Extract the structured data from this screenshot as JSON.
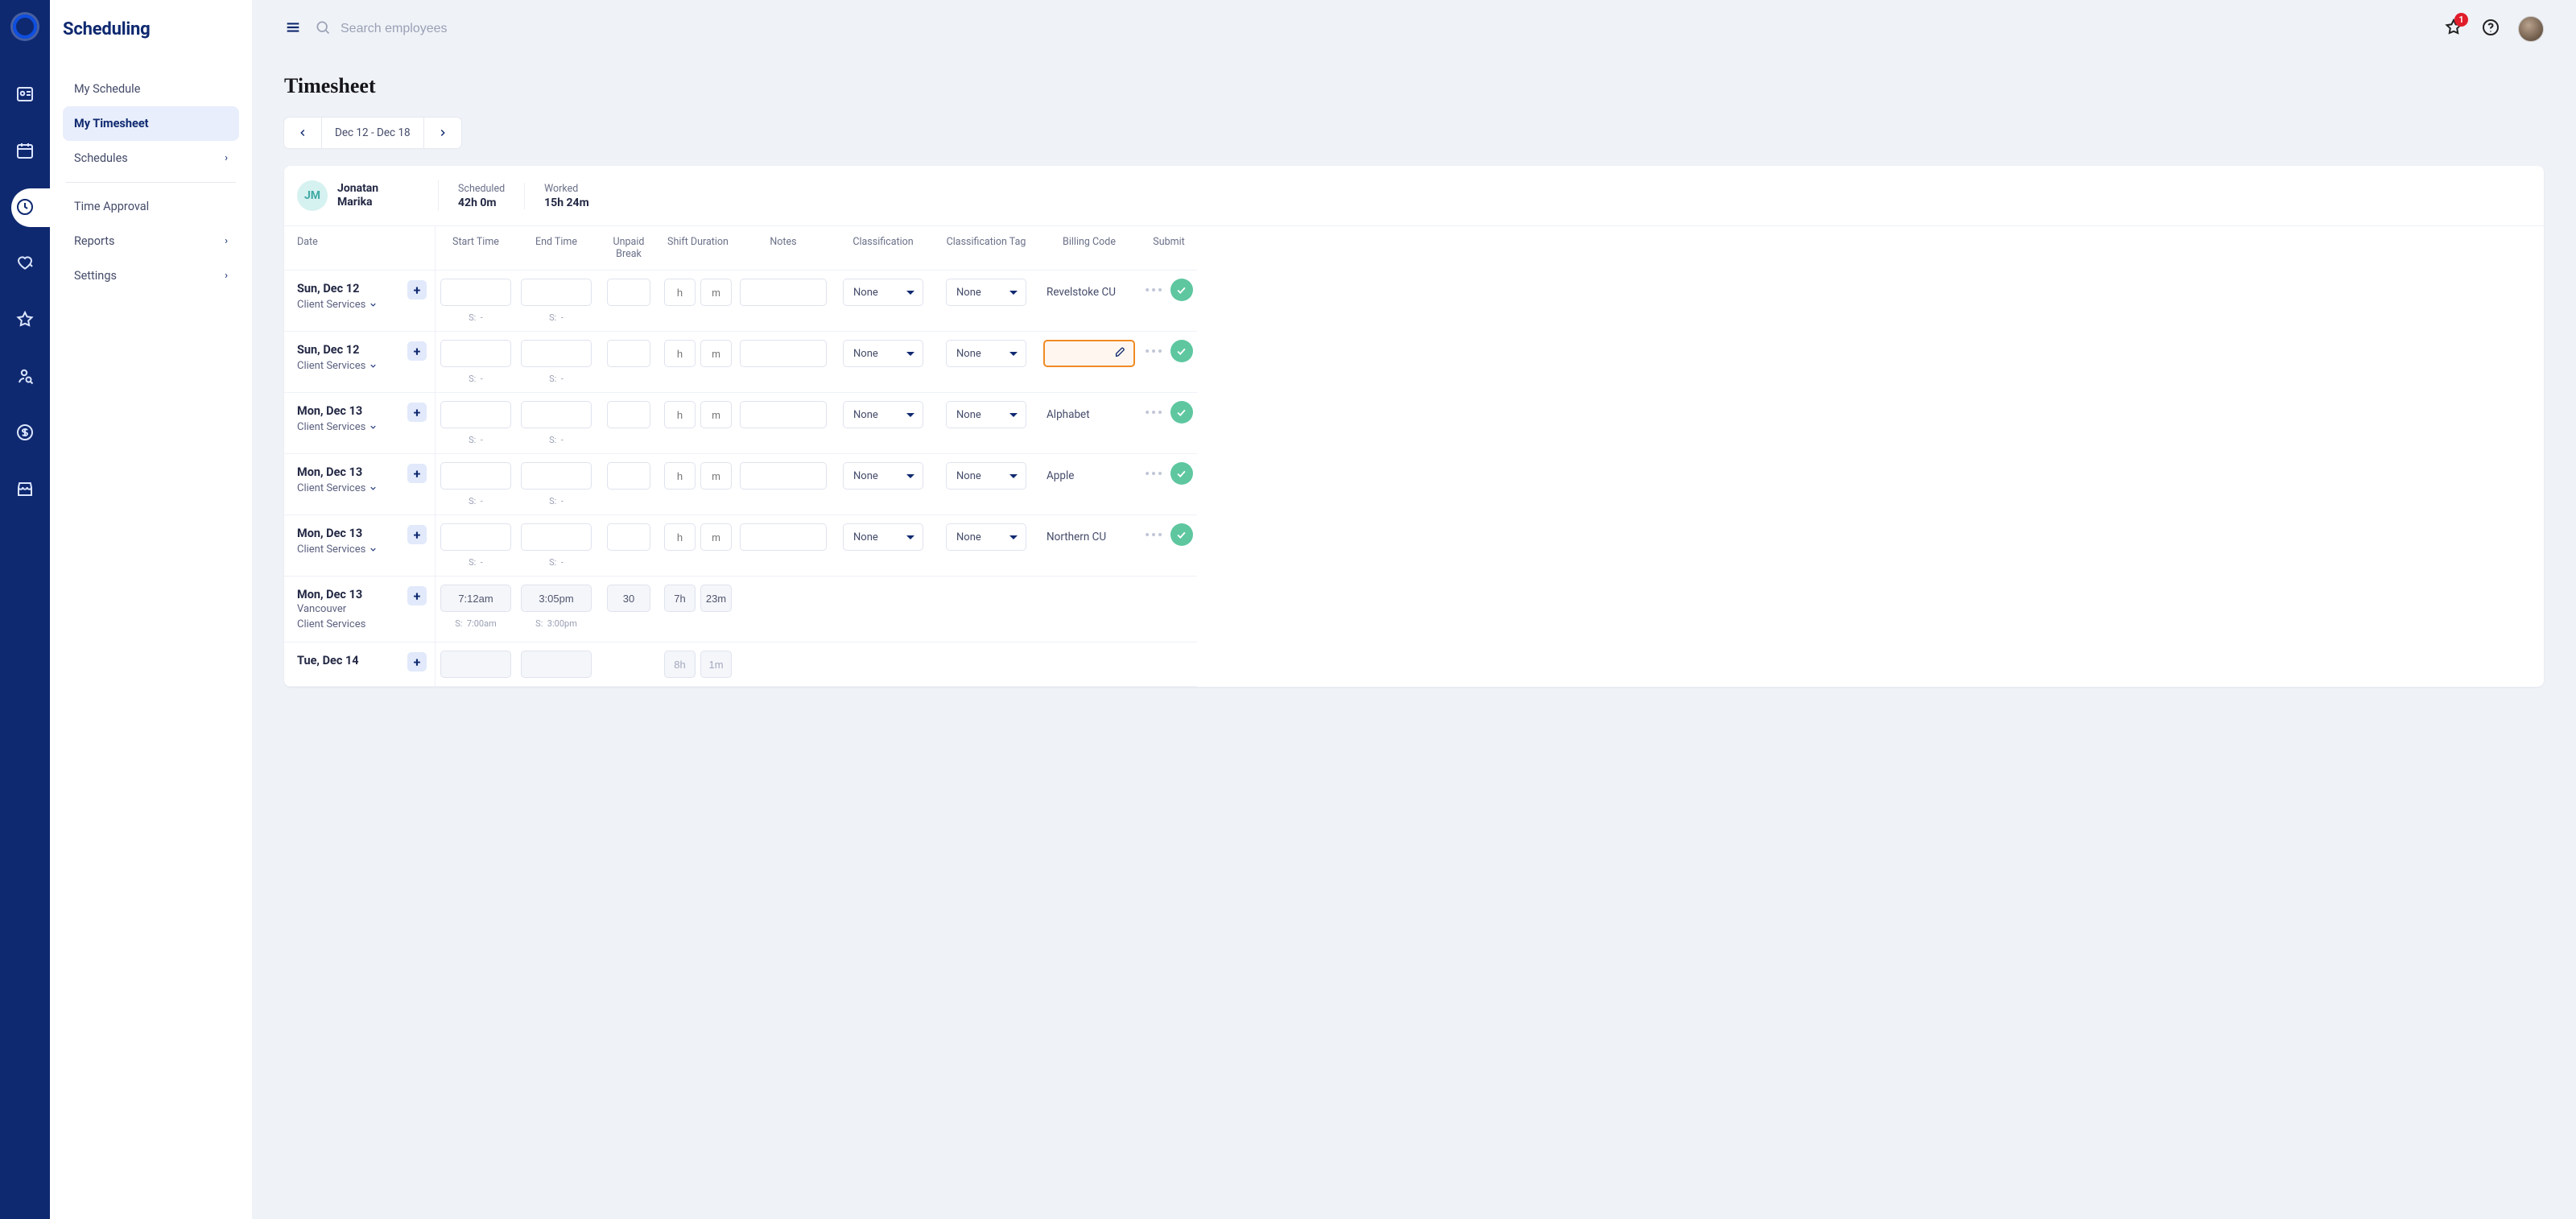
{
  "app": {
    "name": "Scheduling"
  },
  "rail": {
    "items": [
      "logo",
      "directory",
      "calendar",
      "clock",
      "heart",
      "star",
      "search-person",
      "dollar",
      "store"
    ],
    "active_index": 3
  },
  "sidebar": {
    "items": [
      {
        "label": "My Schedule",
        "has_children": false
      },
      {
        "label": "My Timesheet",
        "has_children": false
      },
      {
        "label": "Schedules",
        "has_children": true
      },
      {
        "label": "Time Approval",
        "has_children": false
      },
      {
        "label": "Reports",
        "has_children": true
      },
      {
        "label": "Settings",
        "has_children": true
      }
    ],
    "divider_after_index": 2,
    "active_index": 1
  },
  "topbar": {
    "search_placeholder": "Search employees",
    "notification_count": 1
  },
  "page": {
    "title": "Timesheet",
    "range_label": "Dec 12 - Dec 18"
  },
  "summary": {
    "avatar_initials": "JM",
    "name_line1": "Jonatan",
    "name_line2": "Marika",
    "scheduled_label": "Scheduled",
    "scheduled_value": "42h 0m",
    "worked_label": "Worked",
    "worked_value": "15h 24m"
  },
  "columns": {
    "date": "Date",
    "start": "Start Time",
    "end": "End Time",
    "unpaid": "Unpaid Break",
    "duration": "Shift Duration",
    "notes": "Notes",
    "classification": "Classification",
    "classification_tag": "Classification Tag",
    "billing": "Billing Code",
    "submit": "Submit"
  },
  "placeholders": {
    "h": "h",
    "m": "m"
  },
  "sched_prefix": "S:",
  "dash": "-",
  "none_label": "None",
  "rows": [
    {
      "date": "Sun, Dec 12",
      "department": "Client Services",
      "start": "",
      "end": "",
      "unpaid": "",
      "dur_h": "",
      "dur_m": "",
      "s_start": "-",
      "s_end": "-",
      "classification": "None",
      "classification_tag": "None",
      "billing": "Revelstoke CU",
      "billing_editing": false,
      "submit": true
    },
    {
      "date": "Sun, Dec 12",
      "department": "Client Services",
      "start": "",
      "end": "",
      "unpaid": "",
      "dur_h": "",
      "dur_m": "",
      "s_start": "-",
      "s_end": "-",
      "classification": "None",
      "classification_tag": "None",
      "billing": "",
      "billing_editing": true,
      "submit": true
    },
    {
      "date": "Mon, Dec 13",
      "department": "Client Services",
      "start": "",
      "end": "",
      "unpaid": "",
      "dur_h": "",
      "dur_m": "",
      "s_start": "-",
      "s_end": "-",
      "classification": "None",
      "classification_tag": "None",
      "billing": "Alphabet",
      "billing_editing": false,
      "submit": true
    },
    {
      "date": "Mon, Dec 13",
      "department": "Client Services",
      "start": "",
      "end": "",
      "unpaid": "",
      "dur_h": "",
      "dur_m": "",
      "s_start": "-",
      "s_end": "-",
      "classification": "None",
      "classification_tag": "None",
      "billing": "Apple",
      "billing_editing": false,
      "submit": true
    },
    {
      "date": "Mon, Dec 13",
      "department": "Client Services",
      "start": "",
      "end": "",
      "unpaid": "",
      "dur_h": "",
      "dur_m": "",
      "s_start": "-",
      "s_end": "-",
      "classification": "None",
      "classification_tag": "None",
      "billing": "Northern CU",
      "billing_editing": false,
      "submit": true
    },
    {
      "date": "Mon, Dec 13",
      "location": "Vancouver",
      "department": "Client Services",
      "start": "7:12am",
      "end": "3:05pm",
      "unpaid": "30",
      "dur_h": "7h",
      "dur_m": "23m",
      "readonly": true,
      "s_start": "7:00am",
      "s_end": "3:00pm",
      "classification": "",
      "classification_tag": "",
      "billing": "",
      "billing_editing": false,
      "submit": false
    },
    {
      "date": "Tue, Dec 14",
      "department": "",
      "start": "",
      "end": "",
      "unpaid": "",
      "dur_h": "8h",
      "dur_m": "1m",
      "readonly": true,
      "muted_dur": true,
      "classification": "",
      "classification_tag": "",
      "billing": "",
      "billing_editing": false,
      "submit": false,
      "partial": true
    }
  ]
}
